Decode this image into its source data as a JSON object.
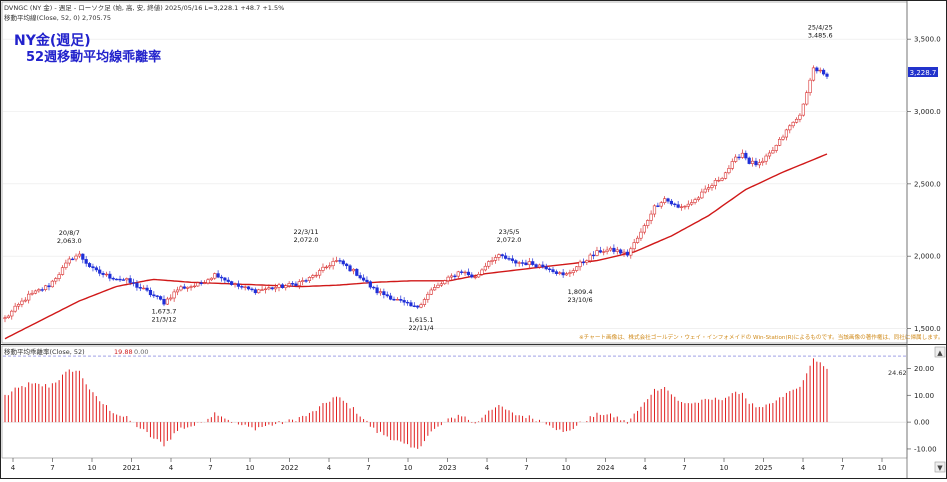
{
  "header": {
    "symbol_line": "DVNGC (NY 金) - 週足 - ローソク足 (始, 高, 安, 終値)   2025/05/16  L=3,228.1  +48.7  +1.5%",
    "ma_line": "移動平均線(Close, 52, 0)  2,705.75",
    "title_line1": "NY金(週足)",
    "title_line2": "52週移動平均線乖離率",
    "last_price_badge": "3,228.7",
    "copyright": "※チャート画像は、株式会社ゴールデン・ウェイ・インフォメイドの Win-Station(R)によるものです。当該画像の著作権は、同社に帰属します。"
  },
  "sub_header": {
    "label": "移動平均乖離率(Close, 52)",
    "value_red": "19.88",
    "value_gray": "0.00",
    "ref_badge": "24.62"
  },
  "colors": {
    "up": "#d83030",
    "down": "#1f2fd8",
    "ma": "#d01818",
    "deviation_bar": "#e02020",
    "title": "#2222cc",
    "badge_bg": "#2233cc"
  },
  "chart_data": [
    {
      "type": "candlestick",
      "title": "NY金(週足)",
      "subtitle": "52週移動平均線乖離率",
      "series": [
        {
          "name": "DVNGC (NY 金)"
        },
        {
          "name": "移動平均線(Close, 52, 0)"
        }
      ],
      "ylim": [
        1400,
        3750
      ],
      "y_ticks": [
        "3,500.0",
        "3,000.0",
        "2,500.0",
        "2,000.0",
        "1,500.0"
      ],
      "y_tick_values": [
        3500,
        3000,
        2500,
        2000,
        1500
      ],
      "x_ticks": [
        "4",
        "7",
        "10",
        "2021",
        "4",
        "7",
        "10",
        "2022",
        "4",
        "7",
        "10",
        "2023",
        "4",
        "7",
        "10",
        "2024",
        "4",
        "7",
        "10",
        "2025",
        "4",
        "7",
        "10"
      ],
      "close_anchors": [
        [
          0,
          1570
        ],
        [
          6,
          1720
        ],
        [
          12,
          1800
        ],
        [
          18,
          1990
        ],
        [
          20,
          2010
        ],
        [
          24,
          1900
        ],
        [
          28,
          1860
        ],
        [
          33,
          1830
        ],
        [
          38,
          1760
        ],
        [
          43,
          1680
        ],
        [
          47,
          1780
        ],
        [
          52,
          1800
        ],
        [
          57,
          1880
        ],
        [
          62,
          1800
        ],
        [
          67,
          1760
        ],
        [
          72,
          1780
        ],
        [
          77,
          1800
        ],
        [
          82,
          1840
        ],
        [
          86,
          1910
        ],
        [
          89,
          1970
        ],
        [
          91,
          1950
        ],
        [
          95,
          1880
        ],
        [
          100,
          1760
        ],
        [
          104,
          1720
        ],
        [
          108,
          1670
        ],
        [
          111,
          1640
        ],
        [
          115,
          1760
        ],
        [
          119,
          1830
        ],
        [
          123,
          1900
        ],
        [
          127,
          1850
        ],
        [
          131,
          1980
        ],
        [
          134,
          2000
        ],
        [
          137,
          1960
        ],
        [
          142,
          1950
        ],
        [
          147,
          1920
        ],
        [
          151,
          1860
        ],
        [
          153,
          1900
        ],
        [
          157,
          1980
        ],
        [
          161,
          2040
        ],
        [
          165,
          2040
        ],
        [
          168,
          2010
        ],
        [
          172,
          2170
        ],
        [
          175,
          2330
        ],
        [
          178,
          2400
        ],
        [
          182,
          2330
        ],
        [
          186,
          2380
        ],
        [
          190,
          2470
        ],
        [
          194,
          2560
        ],
        [
          197,
          2660
        ],
        [
          199,
          2720
        ],
        [
          201,
          2650
        ],
        [
          204,
          2630
        ],
        [
          208,
          2750
        ],
        [
          212,
          2900
        ],
        [
          214,
          2950
        ],
        [
          216,
          3060
        ],
        [
          218,
          3300
        ],
        [
          220,
          3280
        ],
        [
          222,
          3228
        ]
      ],
      "ma_anchors": [
        [
          0,
          1430
        ],
        [
          10,
          1560
        ],
        [
          20,
          1690
        ],
        [
          30,
          1790
        ],
        [
          40,
          1840
        ],
        [
          50,
          1820
        ],
        [
          60,
          1810
        ],
        [
          70,
          1800
        ],
        [
          80,
          1790
        ],
        [
          90,
          1800
        ],
        [
          100,
          1820
        ],
        [
          110,
          1830
        ],
        [
          120,
          1830
        ],
        [
          130,
          1880
        ],
        [
          140,
          1910
        ],
        [
          150,
          1940
        ],
        [
          160,
          1970
        ],
        [
          170,
          2030
        ],
        [
          180,
          2140
        ],
        [
          190,
          2280
        ],
        [
          200,
          2460
        ],
        [
          210,
          2580
        ],
        [
          222,
          2706
        ]
      ],
      "annotations": [
        {
          "date": "20/8/7",
          "value": "2,063.0",
          "week": 19,
          "price": 2063,
          "pos": "above"
        },
        {
          "date": "21/3/12",
          "value": "1,673.7",
          "week": 47,
          "price": 1673.7,
          "pos": "below"
        },
        {
          "date": "22/3/11",
          "value": "2,072.0",
          "week": 89,
          "price": 2072,
          "pos": "above"
        },
        {
          "date": "22/11/4",
          "value": "1,615.1",
          "week": 123,
          "price": 1615.1,
          "pos": "below"
        },
        {
          "date": "23/5/5",
          "value": "2,072.0",
          "week": 149,
          "price": 2072,
          "pos": "above"
        },
        {
          "date": "23/10/6",
          "value": "1,809.4",
          "week": 170,
          "price": 1809.4,
          "pos": "below"
        },
        {
          "date": "25/4/25",
          "value": "3,485.6",
          "week": 241,
          "price": 3485.6,
          "pos": "above"
        }
      ]
    },
    {
      "type": "bar",
      "title": "移動平均乖離率(Close, 52)",
      "series": [
        {
          "name": "移動平均乖離率(Close, 52)"
        }
      ],
      "ylim": [
        -13,
        28
      ],
      "y_ticks": [
        "20.00",
        "10.00",
        "0.00",
        "-10.00"
      ],
      "y_tick_values": [
        20,
        10,
        0,
        -10
      ],
      "reference_line": 24.62,
      "last_value": 19.88
    }
  ]
}
